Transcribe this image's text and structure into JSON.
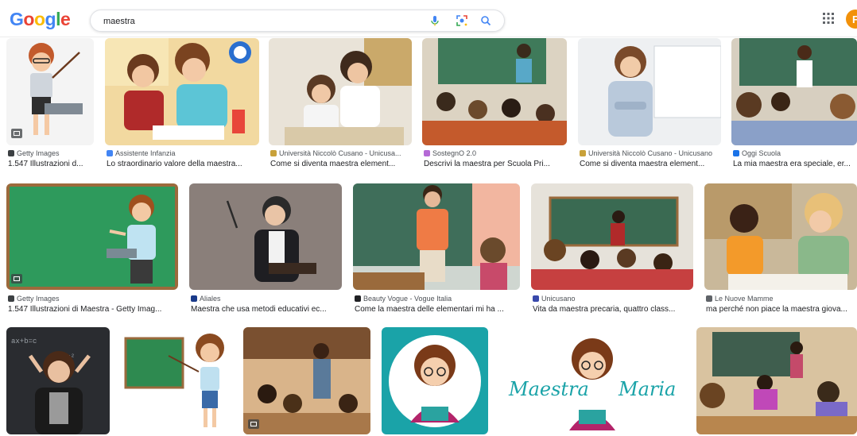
{
  "header": {
    "logo": "Google",
    "logo_colors": [
      "#4285F4",
      "#EA4335",
      "#FBBC05",
      "#4285F4",
      "#34A853",
      "#EA4335"
    ],
    "search_value": "maestra",
    "icons": [
      "mic-icon",
      "lens-icon",
      "search-icon",
      "apps-icon"
    ],
    "avatar_letter": "F",
    "avatar_color": "#f2910a"
  },
  "results": [
    {
      "source": "Getty Images",
      "caption": "1.547 Illustrazioni d...",
      "favicon": "#3c4043"
    },
    {
      "source": "Assistente Infanzia",
      "caption": "Lo straordinario valore della maestra...",
      "favicon": "#4285f4"
    },
    {
      "source": "Università Niccolò Cusano - Unicusa...",
      "caption": "Come si diventa maestra element...",
      "favicon": "#c8a13a"
    },
    {
      "source": "SostegnO 2.0",
      "caption": "Descrivi la maestra per Scuola Pri...",
      "favicon": "#b56ad6"
    },
    {
      "source": "Università Niccolò Cusano - Unicusano",
      "caption": "Come si diventa maestra element...",
      "favicon": "#c8a13a"
    },
    {
      "source": "Oggi Scuola",
      "caption": "La mia maestra era speciale, er...",
      "favicon": "#1a73e8"
    },
    {
      "source": "Getty Images",
      "caption": "1.547 Illustrazioni di Maestra - Getty Imag...",
      "favicon": "#3c4043"
    },
    {
      "source": "Aliales",
      "caption": "Maestra che usa metodi educativi ec...",
      "favicon": "#1a3a8a"
    },
    {
      "source": "Beauty Vogue - Vogue Italia",
      "caption": "Come la maestra delle elementari mi ha ...",
      "favicon": "#202124"
    },
    {
      "source": "Unicusano",
      "caption": "Vita da maestra precaria, quattro class...",
      "favicon": "#3949ab"
    },
    {
      "source": "Le Nuove Mamme",
      "caption": "ma perché non piace la maestra giova...",
      "favicon": "#5f6368"
    },
    {
      "source": "",
      "caption": ""
    },
    {
      "source": "",
      "caption": ""
    },
    {
      "source": "",
      "caption": ""
    },
    {
      "source": "",
      "caption": ""
    },
    {
      "source": "",
      "caption": ""
    },
    {
      "source": "",
      "caption": ""
    }
  ],
  "logo_text_image": {
    "word1": "Maestra",
    "word2": "Maria",
    "color": "#1aa3a8"
  },
  "colors": {
    "teal": "#1aa3a8",
    "chalkboard": "#2e7d4f"
  }
}
